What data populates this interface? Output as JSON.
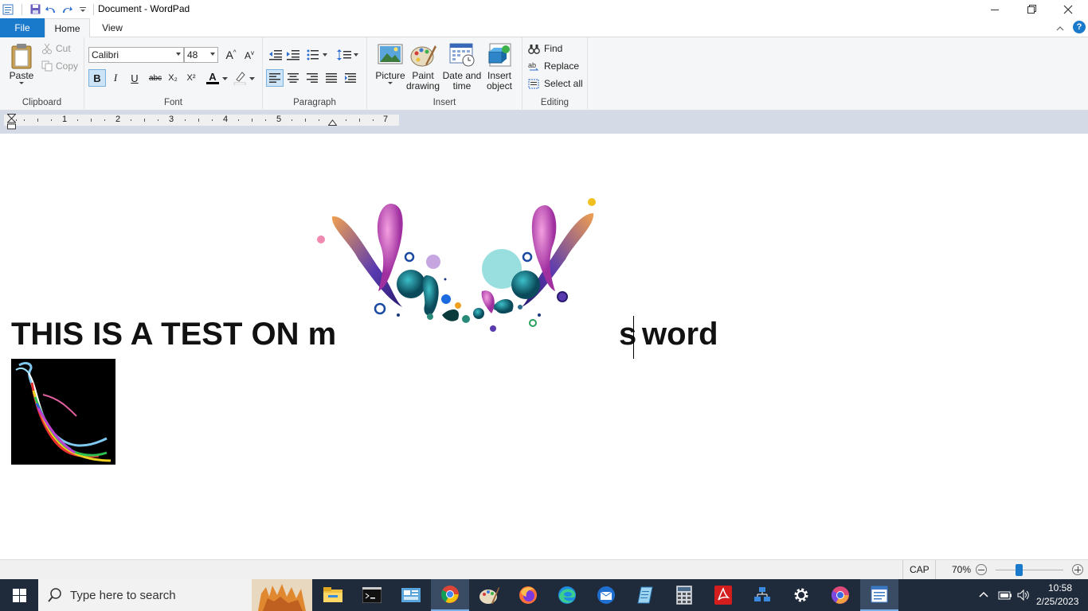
{
  "window": {
    "title": "Document - WordPad"
  },
  "tabs": {
    "file": "File",
    "home": "Home",
    "view": "View"
  },
  "clipboard": {
    "paste": "Paste",
    "cut": "Cut",
    "copy": "Copy",
    "label": "Clipboard"
  },
  "font": {
    "family": "Calibri",
    "size": "48",
    "label": "Font",
    "bold": "B",
    "italic": "I",
    "underline": "U",
    "strike": "abc",
    "subscript": "X₂",
    "superscript": "X²",
    "font_color": "A"
  },
  "paragraph": {
    "label": "Paragraph"
  },
  "insert": {
    "picture": "Picture",
    "paint_drawing_1": "Paint",
    "paint_drawing_2": "drawing",
    "date_time_1": "Date and",
    "date_time_2": "time",
    "insert_object_1": "Insert",
    "insert_object_2": "object",
    "label": "Insert"
  },
  "editing": {
    "find": "Find",
    "replace": "Replace",
    "select_all": "Select all",
    "label": "Editing"
  },
  "ruler": {
    "numbers": [
      "1",
      "2",
      "3",
      "4",
      "5",
      "7"
    ]
  },
  "document": {
    "text_left": "THIS IS A TEST ON m",
    "text_right_s": "s",
    "text_right_word": "word"
  },
  "status": {
    "caps": "CAP",
    "zoom": "70%",
    "zoom_level": 0.7
  },
  "taskbar": {
    "search_placeholder": "Type here to search",
    "time": "10:58",
    "date": "2/25/2023"
  },
  "colors": {
    "file_tab": "#1979ca",
    "ribbon": "#f5f6f7",
    "taskbar": "#1f2a3a",
    "ruler": "#d4dbe7"
  }
}
